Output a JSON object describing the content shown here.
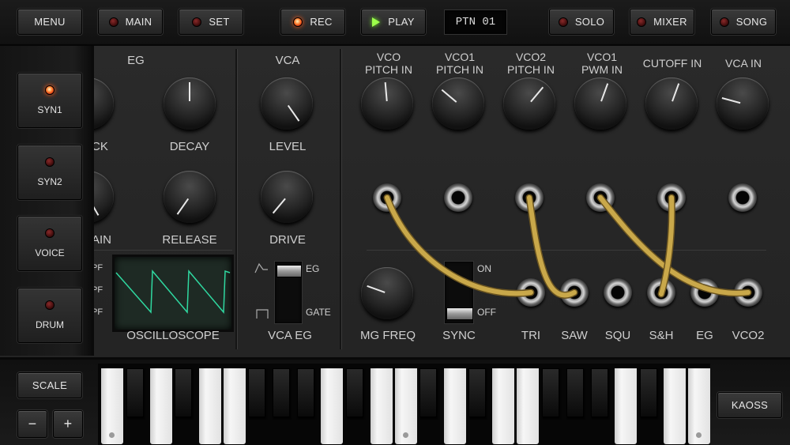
{
  "topbar": {
    "menu": "MENU",
    "main": "MAIN",
    "set": "SET",
    "rec": "REC",
    "play": "PLAY",
    "pattern": "PTN 01",
    "solo": "SOLO",
    "mixer": "MIXER",
    "song": "SONG"
  },
  "sidebar": {
    "items": [
      {
        "label": "SYN1"
      },
      {
        "label": "SYN2"
      },
      {
        "label": "VOICE"
      },
      {
        "label": "DRUM"
      }
    ]
  },
  "eg": {
    "title": "EG",
    "attack_partial": "CK",
    "decay": "DECAY",
    "sustain_partial": "AIN",
    "release": "RELEASE",
    "filter_labels": [
      "PF",
      "PF",
      "PF"
    ]
  },
  "oscilloscope": {
    "label": "OSCILLOSCOPE"
  },
  "vca": {
    "title": "VCA",
    "level": "LEVEL",
    "drive": "DRIVE",
    "eg_label": "VCA EG",
    "switch_top": "EG",
    "switch_bottom": "GATE"
  },
  "patch": {
    "inputs": [
      "VCO\nPITCH IN",
      "VCO1\nPITCH IN",
      "VCO2\nPITCH IN",
      "VCO1\nPWM IN",
      "CUTOFF IN",
      "VCA IN"
    ],
    "mg_freq": "MG FREQ",
    "sync": "SYNC",
    "sync_on": "ON",
    "sync_off": "OFF",
    "outputs": [
      "TRI",
      "SAW",
      "SQU",
      "S&H",
      "EG",
      "VCO2"
    ]
  },
  "keyboard": {
    "scale": "SCALE",
    "minus": "−",
    "plus": "+",
    "kaoss": "KAOSS"
  },
  "colors": {
    "cable": "#c9a84a",
    "led_on": "#ff5a1a",
    "play": "#9cff4a",
    "scope": "#2fd8a0"
  }
}
